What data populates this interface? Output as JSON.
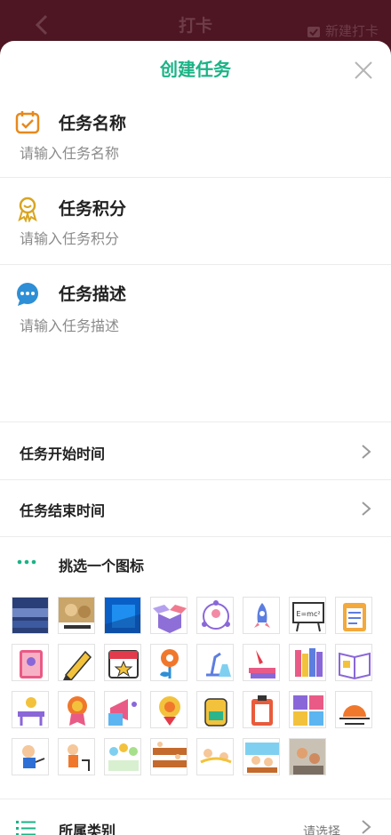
{
  "topbar": {
    "title": "打卡",
    "new_checkin": "新建打卡"
  },
  "sheet": {
    "title": "创建任务"
  },
  "fields": {
    "name": {
      "label": "任务名称",
      "placeholder": "请输入任务名称"
    },
    "points": {
      "label": "任务积分",
      "placeholder": "请输入任务积分"
    },
    "description": {
      "label": "任务描述",
      "placeholder": "请输入任务描述"
    }
  },
  "rows": {
    "start_time": "任务开始时间",
    "end_time": "任务结束时间"
  },
  "icon_picker": {
    "label": "挑选一个图标",
    "icons": [
      "photo-banner-icon",
      "photo-ceremony-icon",
      "windows-logo-icon",
      "open-box-icon",
      "people-network-icon",
      "rocket-icon",
      "blackboard-formula-icon",
      "clipboard-checklist-icon",
      "book-pink-icon",
      "pencil-icon",
      "calendar-star-icon",
      "flower-icon",
      "microscope-flask-icon",
      "ink-pen-books-icon",
      "bookshelf-icon",
      "open-book-icon",
      "teacher-desk-icon",
      "medal-badge-icon",
      "megaphone-music-icon",
      "award-coin-icon",
      "backpack-icon",
      "clipboard-icon",
      "math-operators-icon",
      "sunrise-icon",
      "kid-sticker-1-icon",
      "kid-sticker-2-icon",
      "kids-group-sticker-icon",
      "desks-sticker-icon",
      "kids-running-sticker-icon",
      "kids-classroom-sticker-icon",
      "kids-playing-photo-icon"
    ]
  },
  "category": {
    "label": "所属类别",
    "value": "请选择"
  },
  "colors": {
    "accent": "#1bb386",
    "header_bg": "#4d1622"
  }
}
